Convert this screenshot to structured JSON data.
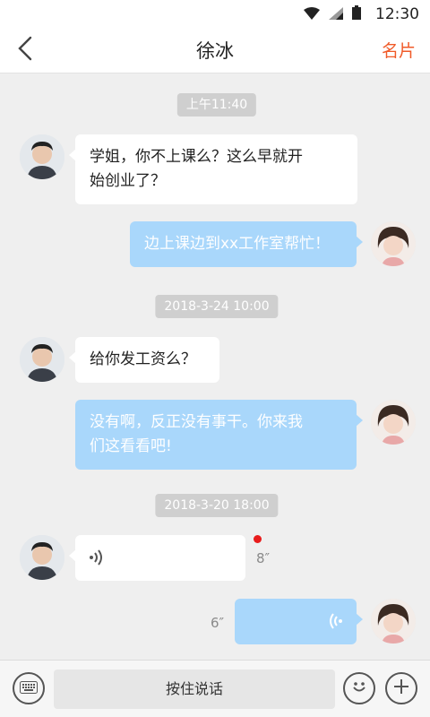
{
  "status_bar": {
    "time": "12:30",
    "icons": [
      "wifi-icon",
      "signal-icon",
      "battery-icon"
    ]
  },
  "header": {
    "back_icon": "chevron-left-icon",
    "title": "徐冰",
    "action_label": "名片",
    "action_color": "#f05a28"
  },
  "messages": [
    {
      "type": "time",
      "text": "上午11:40"
    },
    {
      "type": "text",
      "side": "left",
      "lines": [
        "学姐，你不上课么？这么早就开",
        "始创业了？"
      ]
    },
    {
      "type": "text",
      "side": "right",
      "lines": [
        "边上课边到xx工作室帮忙！"
      ]
    },
    {
      "type": "time",
      "text": "2018-3-24  10:00"
    },
    {
      "type": "text",
      "side": "left",
      "lines": [
        "给你发工资么？"
      ]
    },
    {
      "type": "text",
      "side": "right",
      "lines": [
        "没有啊，反正没有事干。你来我",
        "们这看看吧!"
      ]
    },
    {
      "type": "time",
      "text": "2018-3-20  18:00"
    },
    {
      "type": "voice",
      "side": "left",
      "duration": "8″",
      "unread": true
    },
    {
      "type": "voice",
      "side": "right",
      "duration": "6″"
    }
  ],
  "bottom_bar": {
    "hold_to_talk_label": "按住说话",
    "icons": [
      "keyboard-icon",
      "emoji-icon",
      "plus-icon"
    ]
  },
  "colors": {
    "bubble_right": "#a9d7fb",
    "bubble_left": "#ffffff",
    "background": "#efefef",
    "unread_dot": "#e81c1c"
  }
}
